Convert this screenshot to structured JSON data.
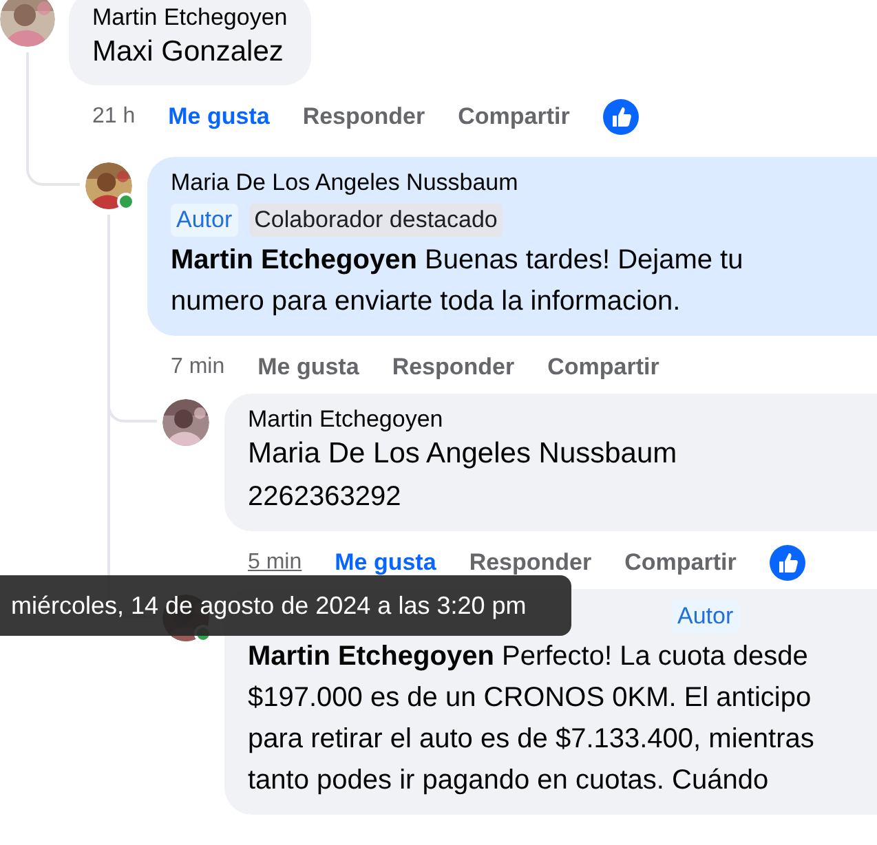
{
  "comments": [
    {
      "author": "Martin Etchegoyen",
      "online": false,
      "highlighted": false,
      "mention": "Maxi Gonzalez",
      "time": "21 h",
      "time_hovered": false,
      "liked": true,
      "actions": [
        "Me gusta",
        "Responder",
        "Compartir"
      ],
      "has_reaction": true,
      "children": [
        {
          "author": "Maria De Los Angeles Nussbaum",
          "online": true,
          "highlighted": true,
          "badges": [
            {
              "kind": "author",
              "label": "Autor"
            },
            {
              "kind": "top_contributor",
              "label": "Colaborador destacado"
            }
          ],
          "badges_wrap": true,
          "text": "**Martin Etchegoyen** Buenas tardes! Dejame tu numero para enviarte toda la informacion.",
          "time": "7 min",
          "time_hovered": false,
          "liked": false,
          "actions": [
            "Me gusta",
            "Responder",
            "Compartir"
          ],
          "children": [
            {
              "author": "Martin Etchegoyen",
              "online": false,
              "highlighted": false,
              "mention": "Maria De Los Angeles Nussbaum",
              "text": "2262363292",
              "time": "5 min",
              "time_hovered": true,
              "liked": true,
              "actions": [
                "Me gusta",
                "Responder",
                "Compartir"
              ],
              "has_reaction": true
            },
            {
              "online": true,
              "highlighted": false,
              "badges": [
                {
                  "kind": "author",
                  "label": "Autor"
                }
              ],
              "badges_wrap": false,
              "text": "**Martin Etchegoyen** Perfecto! La cuota desde $197.000 es de un CRONOS 0KM. El anticipo para retirar el auto es de $7.133.400, mientras tanto podes ir pagando en cuotas. Cuándo"
            }
          ]
        }
      ]
    }
  ],
  "tooltip": {
    "text": "miércoles, 14 de agosto de 2024 a las 3:20 pm"
  }
}
